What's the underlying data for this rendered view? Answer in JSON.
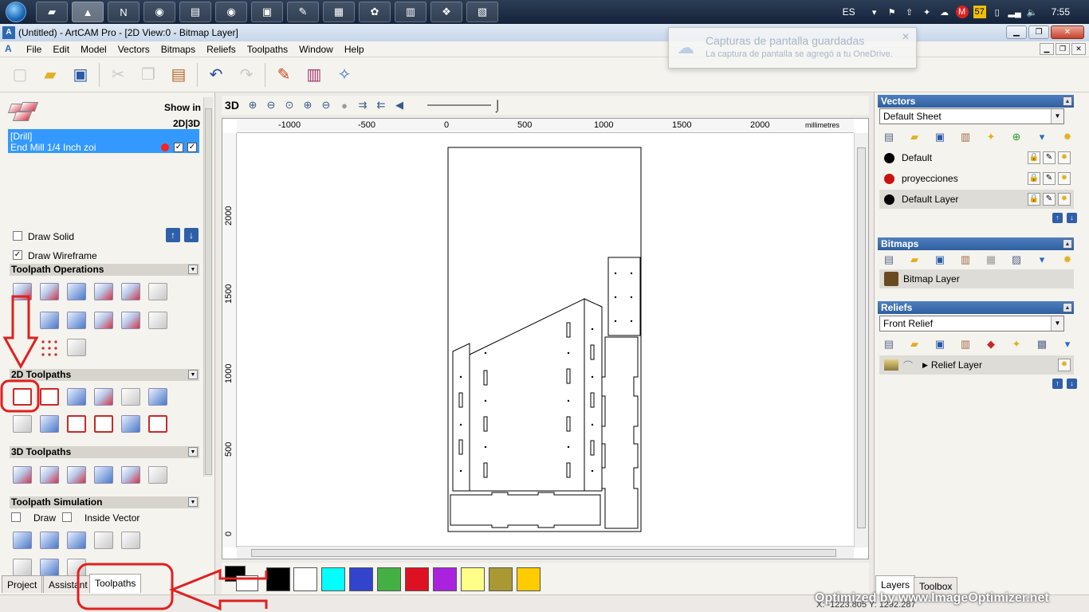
{
  "taskbar": {
    "apps": [
      "desktop-app",
      "artcam-app",
      "notepad-app",
      "chrome-app",
      "explorer-app",
      "chrome-app-2",
      "reader-app",
      "notes-app",
      "winrar-app",
      "paint-app",
      "network-app",
      "gallery-app",
      "screenshot-app"
    ],
    "language": "ES",
    "clock": "7:55",
    "badge": "57"
  },
  "window": {
    "title": "(Untitled) - ArtCAM Pro - [2D View:0 - Bitmap Layer]"
  },
  "menu": [
    "File",
    "Edit",
    "Model",
    "Vectors",
    "Bitmaps",
    "Reliefs",
    "Toolpaths",
    "Window",
    "Help"
  ],
  "notification": {
    "title": "Capturas de pantalla guardadas",
    "body": "La captura de pantalla se agregó a tu OneDrive."
  },
  "toolpath_panel": {
    "show_in": "Show in",
    "dims": "2D|3D",
    "drill_name": "[Drill]",
    "drill_tool": "End Mill 1/4 Inch zoi",
    "draw_solid": "Draw Solid",
    "draw_wireframe": "Draw Wireframe",
    "sections": {
      "ops": "Toolpath Operations",
      "two_d": "2D Toolpaths",
      "three_d": "3D Toolpaths",
      "sim": "Toolpath Simulation"
    },
    "sim_draw": "Draw",
    "sim_inside": "Inside Vector"
  },
  "left_tabs": [
    "Project",
    "Assistant",
    "Toolpaths"
  ],
  "view": {
    "mode": "3D",
    "unit": "millimetres",
    "ruler_x": [
      "-1000",
      "-500",
      "0",
      "500",
      "1000",
      "1500",
      "2000"
    ],
    "ruler_y": [
      "2000",
      "1500",
      "1000",
      "500",
      "0"
    ]
  },
  "palette": [
    "#000000",
    "#ffffff",
    "#00ffff",
    "#3344cc",
    "#44b044",
    "#dd1122",
    "#aa22dd",
    "#ffff88",
    "#aa9933",
    "#ffcc00"
  ],
  "vectors": {
    "header": "Vectors",
    "sheet": "Default Sheet",
    "layers": [
      {
        "name": "Default",
        "color": "#000000"
      },
      {
        "name": "proyecciones",
        "color": "#cc1111"
      },
      {
        "name": "Default Layer",
        "color": "#000000"
      }
    ]
  },
  "bitmaps": {
    "header": "Bitmaps",
    "layer": "Bitmap Layer"
  },
  "reliefs": {
    "header": "Reliefs",
    "relief": "Front Relief",
    "layer": "Relief Layer"
  },
  "right_tabs": [
    "Layers",
    "Toolbox"
  ],
  "status": {
    "coords": "X: -1223.805 Y: 1292.287"
  },
  "watermark": "Optimized by www.ImageOptimizer.net"
}
